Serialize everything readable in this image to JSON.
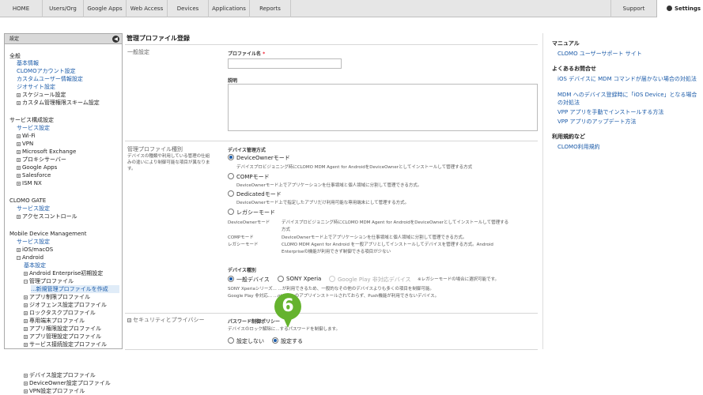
{
  "nav": {
    "items": [
      "HOME",
      "Users/Org",
      "Google Apps",
      "Web Access",
      "Devices",
      "Applications",
      "Reports"
    ],
    "support": "Support",
    "settings": "Settings"
  },
  "sidebar": {
    "header": "設定",
    "items": [
      "全般",
      "基本情報",
      "CLOMOアカウント設定",
      "カスタムユーザー情報設定",
      "ジオサイト設定",
      "スケジュール設定",
      "カスタム管理権限スキーム設定",
      "サービス構成設定",
      "サービス設定",
      "Wi-Fi",
      "VPN",
      "Microsoft Exchange",
      "プロキシサーバー",
      "Google Apps",
      "Salesforce",
      "ISM NX",
      "CLOMO GATE",
      "サービス設定",
      "アクセスコントロール",
      "Mobile Device Management",
      "サービス設定",
      "iOS/macOS",
      "Android",
      "基本設定",
      "Android Enterprise初期設定",
      "管理プロファイル",
      "...新規管理プロファイルを作成",
      "アプリ制限プロファイル",
      "ジオフェンス設定プロファイル",
      "ロックタスクプロファイル",
      "専用端末プロファイル",
      "アプリ権限設定プロファイル",
      "アプリ管理設定プロファイル",
      "サービス接続設定プロファイル"
    ],
    "below": [
      "デバイス設定プロファイル",
      "DeviceOwner設定プロファイル",
      "VPN設定プロファイル"
    ]
  },
  "main": {
    "title": "管理プロファイル登録",
    "general": "一般設定",
    "profile_name_label": "プロファイル名",
    "required_mark": "*",
    "profile_name_value": "",
    "description_label": "説明",
    "description_value": "",
    "type_section": "管理プロファイル種別",
    "type_desc_1": "デバイスの種類や利用している管理の仕組",
    "type_desc_2": "みの違いにより制御可能な項目が異なりま",
    "type_desc_3": "す。",
    "method_label": "デバイス管理方式",
    "opt1": "DeviceOwnerモード",
    "opt1_desc": "デバイスプロビジョニング時にCLOMO MDM Agent for AndroidをDeviceOwnerとしてインストールして管理する方式",
    "opt2": "COMPモード",
    "opt2_desc": "DeviceOwnerモード上でアプリケーションを仕事領域と個人領域に分割して管理できる方式。",
    "opt3": "Dedicatedモード",
    "opt3_desc": "DeviceOwnerモード上で指定したアプリだけ利用可能な専用端末にして管理する方式。",
    "opt4": "レガシーモード",
    "sum1_k": "DeviceOwnerモード",
    "sum1_v1": "デバイスプロビジョニング時にCLOMO MDM Agent for AndroidをDeviceOwnerとしてインストールして管理する",
    "sum1_v2": "方式",
    "sum2_k": "COMPモード",
    "sum2_v": "DeviceOwnerモード上でアプリケーションを仕事領域と個人領域に分割して管理できる方式。",
    "sum3_k": "レガシーモード",
    "sum3_v1": "CLOMO MDM Agent for Android を一般アプリとしてインストールしてデバイスを管理する方式。Android",
    "sum3_v2": "Enterpriseの機能が利用できず制御できる項目が少ない",
    "devtype_label": "デバイス種別",
    "dt1": "一般デバイス",
    "dt2": "SONY Xperia",
    "dt3": "Google Play 非対応デバイス",
    "dt3_note": "※レガシーモードの場合に選択可能です。",
    "dt_note1": "SONY Xperiaシリーズ...             ...が利用できるため、一般的なその他のデバイスよりも多くの項目を制御可能。",
    "dt_note2": "Google Play 非対応...             ...gle Playのアプリインストールされておらず、Push機能が利用できないデバイス。",
    "security_section": "セキュリティとプライバシー",
    "pw_label": "パスワード制御ポリシー",
    "pw_desc": "デバイスのロック解除に...するパスワードを制御します。",
    "pw_opt1": "設定しない",
    "pw_opt2": "設定する",
    "step": "6"
  },
  "right": {
    "manual_h": "マニュアル",
    "manual_link": "CLOMO ユーザーサポート サイト",
    "faq_h": "よくあるお問合せ",
    "faq1": "iOS デバイスに MDM コマンドが届かない場合の対処法",
    "faq2": "MDM へのデバイス登録時に「iOS Device」となる場合の対処法",
    "faq3": "VPP アプリを手動でインストールする方法",
    "faq4": "VPP アプリのアップデート方法",
    "terms_h": "利用規約など",
    "terms_link": "CLOMO利用規約"
  },
  "colors": {
    "link": "#1a5aa8",
    "badge": "#65b32e",
    "required": "#e22233"
  }
}
